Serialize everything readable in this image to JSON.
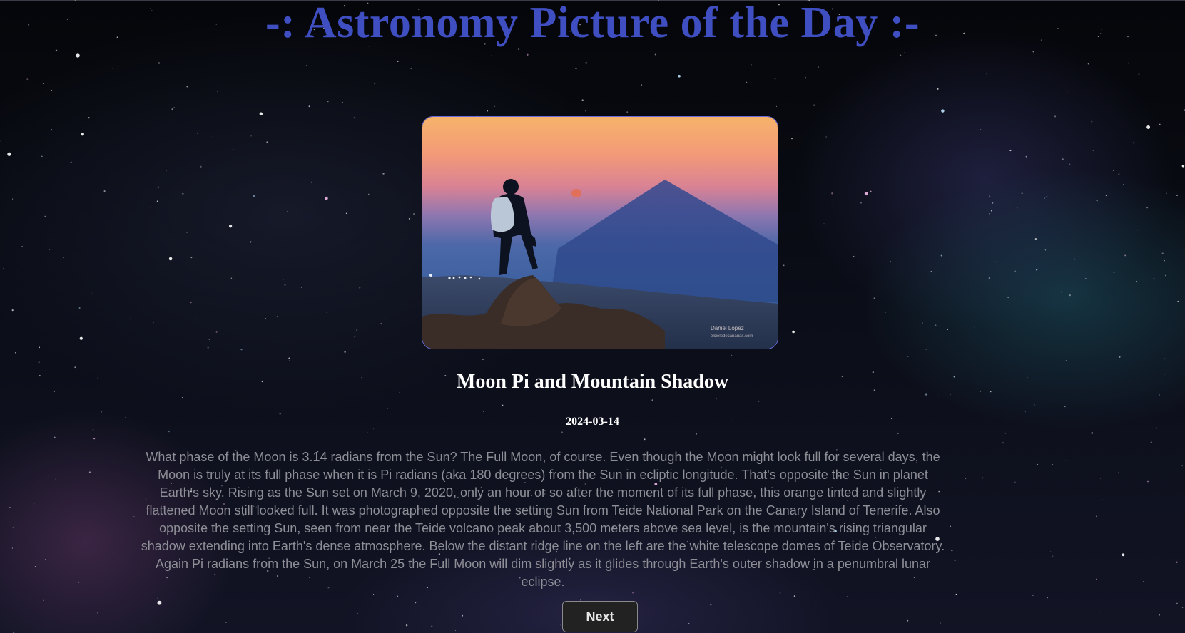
{
  "page": {
    "title": "-: Astronomy Picture of the Day :-"
  },
  "apod": {
    "image_credit_line1": "Daniel López",
    "image_credit_line2": "elcielodecanarias.com",
    "title": "Moon Pi and Mountain Shadow",
    "date": "2024-03-14",
    "explanation": "What phase of the Moon is 3.14 radians from the Sun? The Full Moon, of course. Even though the Moon might look full for several days, the Moon is truly at its full phase when it is Pi radians (aka 180 degrees) from the Sun in ecliptic longitude. That's opposite the Sun in planet Earth's sky. Rising as the Sun set on March 9, 2020, only an hour or so after the moment of its full phase, this orange tinted and slightly flattened Moon still looked full. It was photographed opposite the setting Sun from Teide National Park on the Canary Island of Tenerife. Also opposite the setting Sun, seen from near the Teide volcano peak about 3,500 meters above sea level, is the mountain's rising triangular shadow extending into Earth's dense atmosphere. Below the distant ridge line on the left are the white telescope domes of Teide Observatory. Again Pi radians from the Sun, on March 25 the Full Moon will dim slightly as it glides through Earth's outer shadow in a penumbral lunar eclipse."
  },
  "navigation": {
    "next_label": "Next"
  },
  "colors": {
    "title": "#3f4fc2",
    "card_border": "#6a6ad8",
    "explanation_text": "#8e8e96",
    "button_bg": "#222222"
  }
}
